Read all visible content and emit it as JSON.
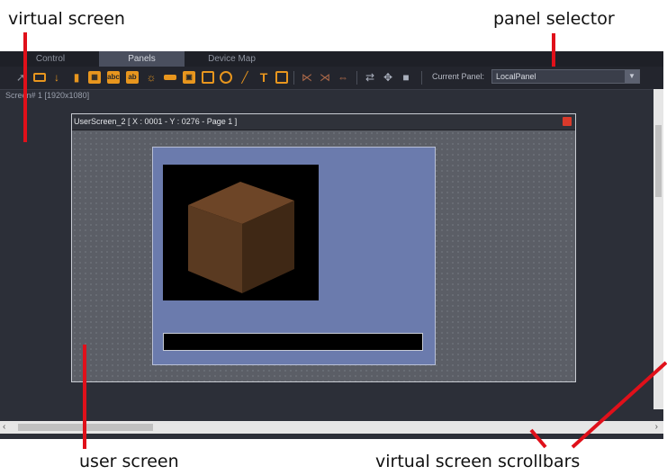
{
  "annotations": {
    "virtual_screen": "virtual screen",
    "panel_selector": "panel selector",
    "user_screen": "user screen",
    "scrollbars": "virtual screen scrollbars"
  },
  "tabs": [
    {
      "label": "Control",
      "active": false
    },
    {
      "label": "Panels",
      "active": true
    },
    {
      "label": "Device Map",
      "active": false
    }
  ],
  "toolbar": {
    "icons": [
      "pointer-icon",
      "button-icon",
      "slider-icon",
      "fader-icon",
      "image-icon",
      "label-icon",
      "text-icon",
      "light-icon",
      "bar-icon",
      "frame-icon",
      "rectangle-icon",
      "circle-icon",
      "line-icon",
      "text-tool-icon",
      "picture-icon",
      "align-left-icon",
      "align-right-icon",
      "link-icon",
      "swap-icon",
      "move-icon",
      "stop-icon"
    ],
    "current_panel_label": "Current Panel:",
    "current_panel_value": "LocalPanel"
  },
  "screen": {
    "label": "Screen# 1 [1920x1080]"
  },
  "user_screen": {
    "title": "UserScreen_2 [ X : 0001 - Y : 0276 - Page 1 ]"
  },
  "colors": {
    "accent": "#e8961e",
    "annotation_line": "#e0101a",
    "panel_bg": "#6b7bad"
  }
}
